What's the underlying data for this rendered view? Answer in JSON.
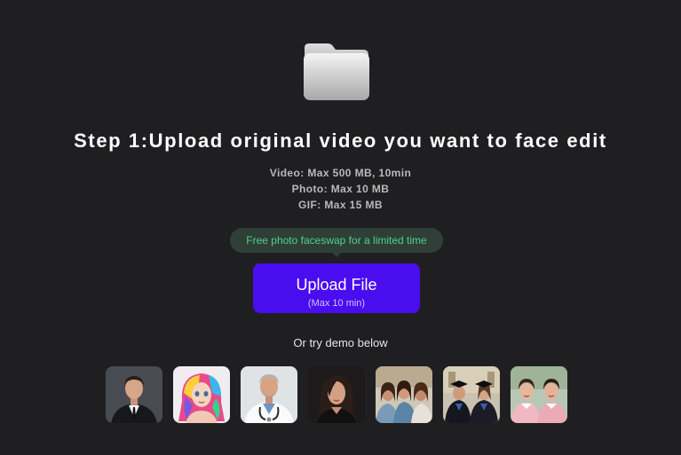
{
  "header": {
    "icon": "folder-icon",
    "title": "Step 1:Upload original video you want to face edit"
  },
  "limits": {
    "video": "Video: Max 500 MB, 10min",
    "photo": "Photo: Max 10 MB",
    "gif": "GIF: Max 15 MB"
  },
  "promo": {
    "text": "Free photo faceswap for a limited time"
  },
  "upload": {
    "label": "Upload File",
    "sublabel": "(Max 10 min)"
  },
  "demo": {
    "label": "Or try demo below",
    "thumbnails": [
      {
        "icon": "man-in-suit-thumbnail"
      },
      {
        "icon": "rainbow-hair-girl-thumbnail"
      },
      {
        "icon": "doctor-thumbnail"
      },
      {
        "icon": "woman-dark-hair-thumbnail"
      },
      {
        "icon": "three-women-thumbnail"
      },
      {
        "icon": "graduates-thumbnail"
      },
      {
        "icon": "vintage-women-thumbnail"
      }
    ]
  },
  "colors": {
    "background": "#1f1f21",
    "accent": "#4a0df0",
    "promo_text": "#4fd08c",
    "promo_bg": "#2f3f38"
  }
}
